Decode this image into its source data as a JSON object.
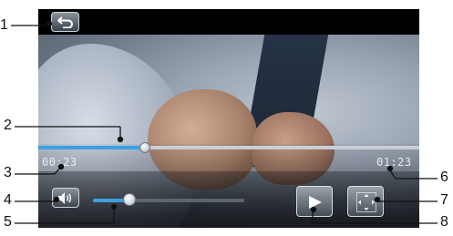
{
  "player": {
    "elapsed_time": "00:23",
    "total_time": "01:23",
    "progress": 0.28,
    "volume": 0.24
  },
  "callouts": {
    "c1": "1",
    "c2": "2",
    "c3": "3",
    "c4": "4",
    "c5": "5",
    "c6": "6",
    "c7": "7",
    "c8": "8"
  },
  "icons": {
    "back": "back-arrow-icon",
    "volume": "speaker-icon",
    "play": "play-icon",
    "fullscreen": "fullscreen-icon"
  },
  "colors": {
    "accent": "#3aa0e3",
    "screen_bg": "#000000"
  }
}
